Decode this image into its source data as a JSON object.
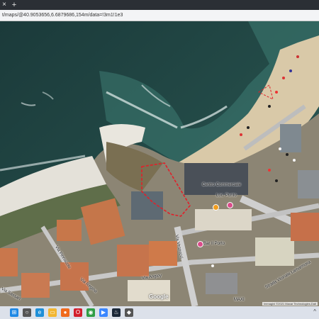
{
  "browser": {
    "tab_icon": "close-icon",
    "tab_close_glyph": "×",
    "new_tab_glyph": "+",
    "url": "t/maps/@40.9053656,6.6879686,154m/data=!3m1!1e3"
  },
  "map": {
    "labels": {
      "via_pinnacolo": "Via Pinnacolo",
      "via_regina": "Via Regina",
      "via_vespucci": "Via Vespucci",
      "via_angioy": "Via Angioy",
      "via_sassari": "Via Sassari",
      "via_lamarmora": "Strada Vicinale Lamarmora",
      "poi_center": "Centro Commerciale",
      "poi_pink": "Loc. Punto",
      "poi_bar": "Bar Il Porto",
      "maxi": "MAXI",
      "google": "Google"
    },
    "attribution": "Immagini ©2021 Maxar Technologies,Dati"
  },
  "taskbar": {
    "icons": [
      {
        "name": "windows-start-icon",
        "glyph": "⊞",
        "color": "#1e88e5"
      },
      {
        "name": "search-icon",
        "glyph": "○",
        "color": "#555555"
      },
      {
        "name": "edge-icon",
        "glyph": "e",
        "color": "#1f8fd8"
      },
      {
        "name": "folder-icon",
        "glyph": "▭",
        "color": "#f2b632"
      },
      {
        "name": "firefox-icon",
        "glyph": "●",
        "color": "#f06a1d"
      },
      {
        "name": "opera-icon",
        "glyph": "O",
        "color": "#d21f2c"
      },
      {
        "name": "chrome-icon",
        "glyph": "◉",
        "color": "#2f9e44"
      },
      {
        "name": "media-icon",
        "glyph": "▶",
        "color": "#3a86ff"
      },
      {
        "name": "steam-icon",
        "glyph": "♨",
        "color": "#1b2838"
      },
      {
        "name": "app-icon",
        "glyph": "◆",
        "color": "#555555"
      }
    ],
    "expand_glyph": "^"
  }
}
